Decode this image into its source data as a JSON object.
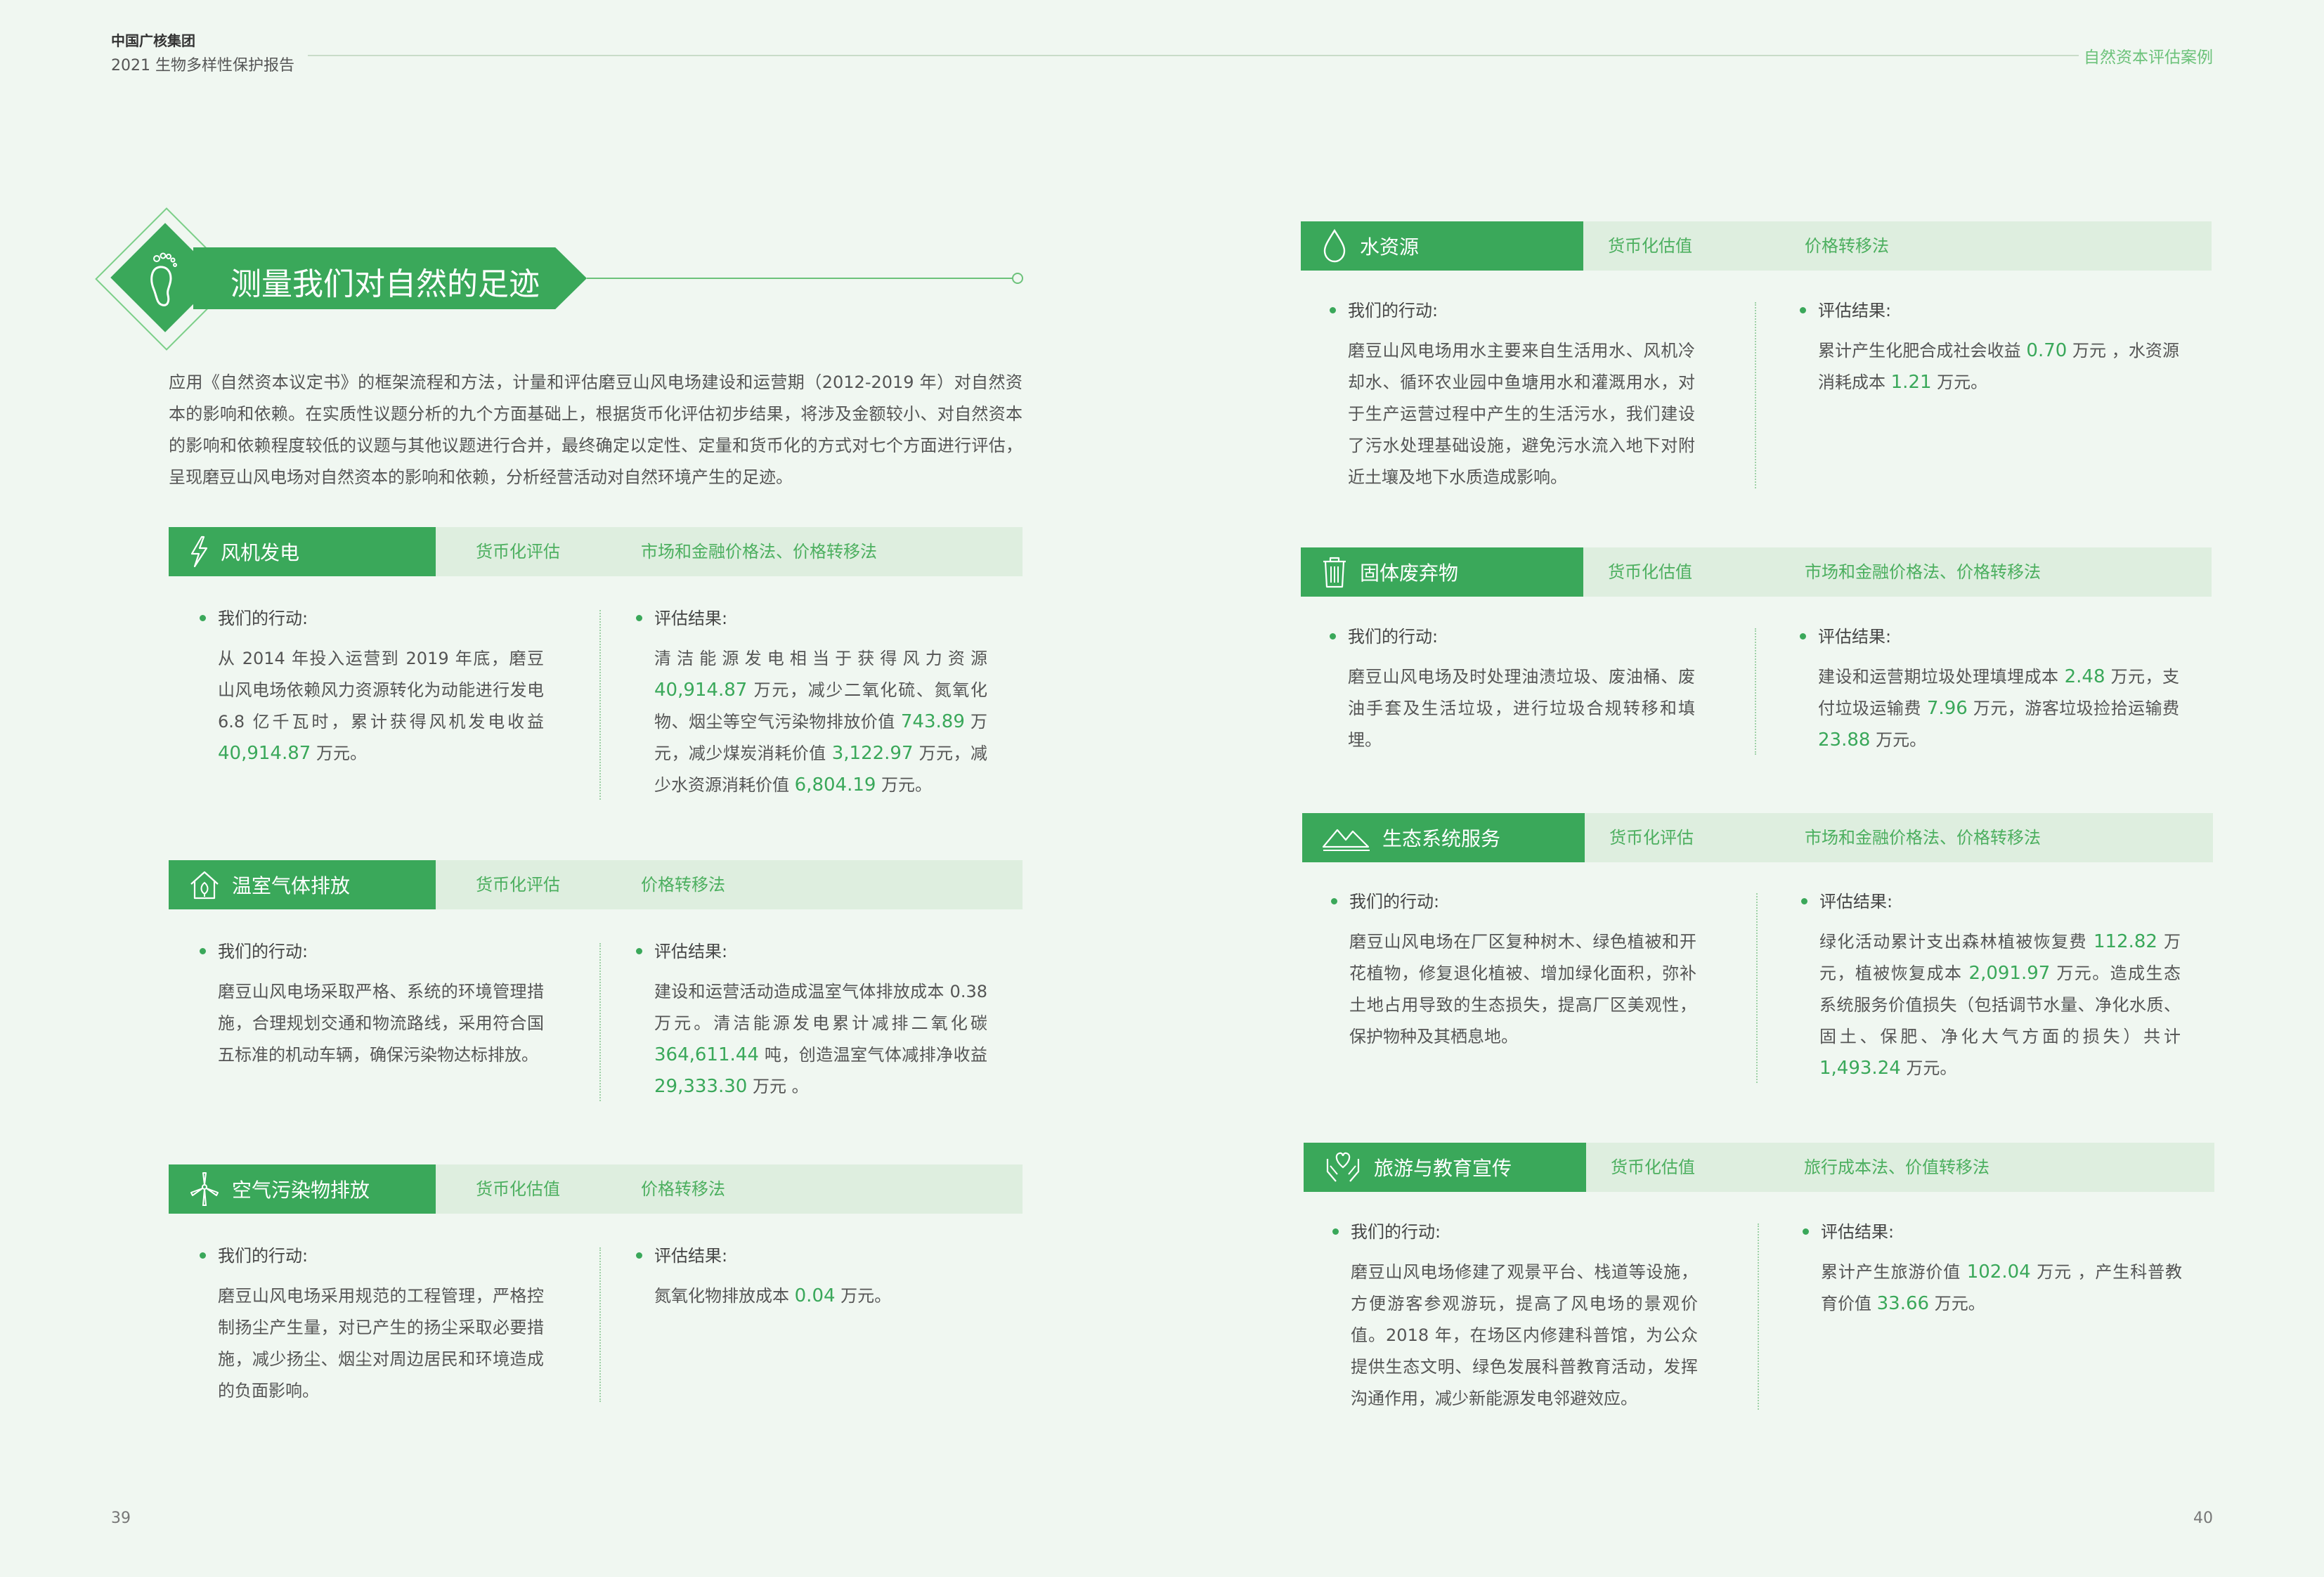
{
  "header": {
    "company": "中国广核集团",
    "report": "2021 生物多样性保护报告",
    "section": "自然资本评估案例"
  },
  "pages": {
    "left": "39",
    "right": "40"
  },
  "title": {
    "text": "测量我们对自然的足迹",
    "icon": "footprint-icon"
  },
  "intro": "应用《自然资本议定书》的框架流程和方法，计量和评估磨豆山风电场建设和运营期（2012-2019 年）对自然资本的影响和依赖。在实质性议题分析的九个方面基础上，根据货币化评估初步结果，将涉及金额较小、对自然资本的影响和依赖程度较低的议题与其他议题进行合并，最终确定以定性、定量和货币化的方式对七个方面进行评估，呈现磨豆山风电场对自然资本的影响和依赖，分析经营活动对自然环境产生的足迹。",
  "labels": {
    "action": "我们的行动:",
    "result": "评估结果:"
  },
  "sections": {
    "wind": {
      "title": "风机发电",
      "icon": "lightning-icon",
      "method1": "货币化评估",
      "method2": "市场和金融价格法、价格转移法",
      "action": [
        "从 2014 年投入运营到 2019 年底，磨豆山风电场依赖风力资源转化为动能进行发电 6.8 亿千瓦时，累计获得风机发电收益 ",
        "40,914.87",
        " 万元。"
      ],
      "result": [
        "清洁能源发电相当于获得风力资源 ",
        "40,914.87",
        " 万元，减少二氧化硫、氮氧化物、烟尘等空气污染物排放价值 ",
        "743.89",
        " 万元，减少煤炭消耗价值 ",
        "3,122.97",
        " 万元，减少水资源消耗价值 ",
        "6,804.19",
        " 万元。"
      ]
    },
    "ghg": {
      "title": "温室气体排放",
      "icon": "house-icon",
      "method1": "货币化评估",
      "method2": "价格转移法",
      "action": [
        "磨豆山风电场采取严格、系统的环境管理措施，合理规划交通和物流路线，采用符合国五标准的机动车辆，确保污染物达标排放。"
      ],
      "result": [
        "建设和运营活动造成温室气体排放成本 0.38 万元。清洁能源发电累计减排二氧化碳 ",
        "364,611.44",
        " 吨，创造温室气体减排净收益 ",
        "29,333.30",
        " 万元 。"
      ]
    },
    "air": {
      "title": "空气污染物排放",
      "icon": "wind-turbine-icon",
      "method1": "货币化估值",
      "method2": "价格转移法",
      "action": [
        "磨豆山风电场采用规范的工程管理，严格控制扬尘产生量，对已产生的扬尘采取必要措施，减少扬尘、烟尘对周边居民和环境造成的负面影响。"
      ],
      "result": [
        "氮氧化物排放成本 ",
        "0.04",
        " 万元。"
      ]
    },
    "water": {
      "title": "水资源",
      "icon": "water-drop-icon",
      "method1": "货币化估值",
      "method2": "价格转移法",
      "action": [
        "磨豆山风电场用水主要来自生活用水、风机冷却水、循环农业园中鱼塘用水和灌溉用水，对于生产运营过程中产生的生活污水，我们建设了污水处理基础设施，避免污水流入地下对附近土壤及地下水质造成影响。"
      ],
      "result": [
        "累计产生化肥合成社会收益 ",
        "0.70",
        " 万元 ，水资源消耗成本 ",
        "1.21",
        " 万元。"
      ]
    },
    "waste": {
      "title": "固体废弃物",
      "icon": "trash-icon",
      "method1": "货币化估值",
      "method2": "市场和金融价格法、价格转移法",
      "action": [
        "磨豆山风电场及时处理油渍垃圾、废油桶、废油手套及生活垃圾，进行垃圾合规转移和填埋。"
      ],
      "result": [
        "建设和运营期垃圾处理填埋成本 ",
        "2.48",
        " 万元，支付垃圾运输费 ",
        "7.96",
        " 万元，游客垃圾捡拾运输费 ",
        "23.88",
        " 万元。"
      ]
    },
    "eco": {
      "title": "生态系统服务",
      "icon": "mountains-icon",
      "method1": "货币化评估",
      "method2": "市场和金融价格法、价格转移法",
      "action": [
        "磨豆山风电场在厂区复种树木、绿色植被和开花植物，修复退化植被、增加绿化面积，弥补土地占用导致的生态损失，提高厂区美观性，保护物种及其栖息地。"
      ],
      "result": [
        "绿化活动累计支出森林植被恢复费 ",
        "112.82",
        " 万元，植被恢复成本 ",
        "2,091.97",
        " 万元。造成生态系统服务价值损失（包括调节水量、净化水质、固土、保肥、净化大气方面的损失）共计 ",
        "1,493.24",
        " 万元。"
      ]
    },
    "tour": {
      "title": "旅游与教育宣传",
      "icon": "hands-heart-icon",
      "method1": "货币化估值",
      "method2": "旅行成本法、价值转移法",
      "action": [
        "磨豆山风电场修建了观景平台、栈道等设施，方便游客参观游玩，提高了风电场的景观价值。2018 年，在场区内修建科普馆，为公众提供生态文明、绿色发展科普教育活动，发挥沟通作用，减少新能源发电邻避效应。"
      ],
      "result": [
        "累计产生旅游价值 ",
        "102.04",
        " 万元 ，产生科普教育价值 ",
        "33.66",
        " 万元。"
      ]
    }
  }
}
